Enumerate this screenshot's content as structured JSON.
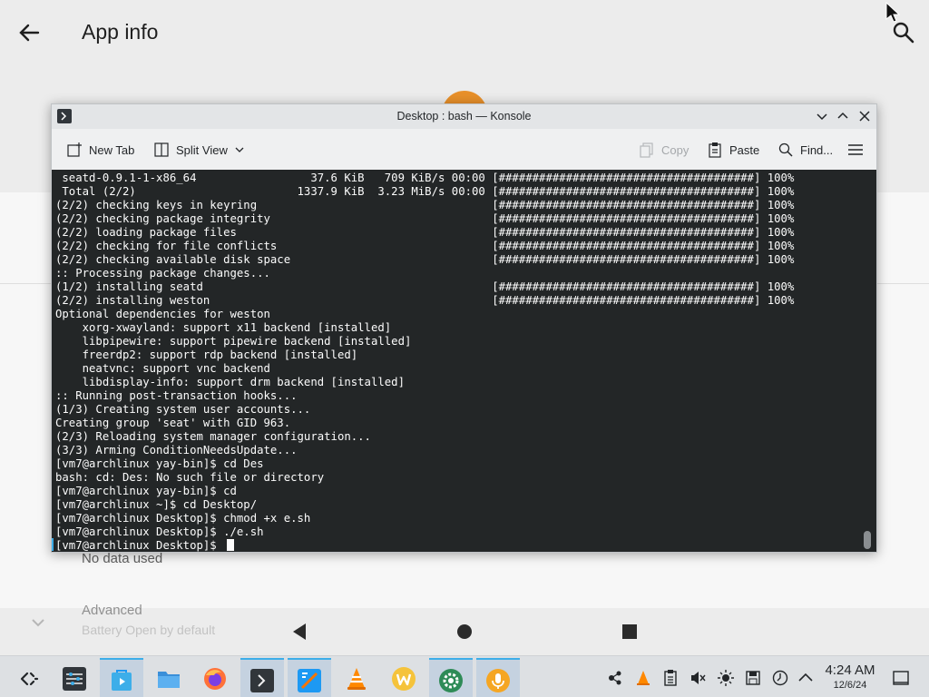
{
  "android": {
    "title": "App info",
    "no_data_text": "No data used",
    "advanced_title": "Advanced",
    "advanced_subtitle": "Battery Open by default"
  },
  "konsole": {
    "window_title": "Desktop : bash — Konsole",
    "toolbar": {
      "new_tab": "New Tab",
      "split_view": "Split View",
      "copy": "Copy",
      "paste": "Paste",
      "find": "Find..."
    },
    "terminal_lines": [
      " seatd-0.9.1-1-x86_64                 37.6 KiB   709 KiB/s 00:00 [######################################] 100%",
      " Total (2/2)                        1337.9 KiB  3.23 MiB/s 00:00 [######################################] 100%",
      "(2/2) checking keys in keyring                                   [######################################] 100%",
      "(2/2) checking package integrity                                 [######################################] 100%",
      "(2/2) loading package files                                      [######################################] 100%",
      "(2/2) checking for file conflicts                                [######################################] 100%",
      "(2/2) checking available disk space                              [######################################] 100%",
      ":: Processing package changes...",
      "(1/2) installing seatd                                           [######################################] 100%",
      "(2/2) installing weston                                          [######################################] 100%",
      "Optional dependencies for weston",
      "    xorg-xwayland: support x11 backend [installed]",
      "    libpipewire: support pipewire backend [installed]",
      "    freerdp2: support rdp backend [installed]",
      "    neatvnc: support vnc backend",
      "    libdisplay-info: support drm backend [installed]",
      ":: Running post-transaction hooks...",
      "(1/3) Creating system user accounts...",
      "Creating group 'seat' with GID 963.",
      "(2/3) Reloading system manager configuration...",
      "(3/3) Arming ConditionNeedsUpdate...",
      "[vm7@archlinux yay-bin]$ cd Des",
      "bash: cd: Des: No such file or directory",
      "[vm7@archlinux yay-bin]$ cd",
      "[vm7@archlinux ~]$ cd Desktop/",
      "[vm7@archlinux Desktop]$ chmod +x e.sh",
      "[vm7@archlinux Desktop]$ ./e.sh",
      "[vm7@archlinux Desktop]$ "
    ]
  },
  "taskbar": {
    "tasks": [
      {
        "name": "application-launcher",
        "color": "#232629"
      },
      {
        "name": "system-settings",
        "color": "#31363b"
      },
      {
        "name": "discover",
        "color": "#3daee9"
      },
      {
        "name": "dolphin",
        "color": "#3a8fd9"
      },
      {
        "name": "firefox",
        "color": "#ff7139"
      },
      {
        "name": "konsole",
        "color": "#31363b"
      },
      {
        "name": "kate",
        "color": "#1d99f3"
      },
      {
        "name": "vlc",
        "color": "#ff8800"
      },
      {
        "name": "waydroid-app",
        "color": "#f5c33b"
      },
      {
        "name": "waydroid-settings",
        "color": "#2e8b57"
      },
      {
        "name": "voice-recorder",
        "color": "#f5a623"
      }
    ],
    "clock_time": "4:24 AM",
    "clock_date": "12/6/24"
  }
}
